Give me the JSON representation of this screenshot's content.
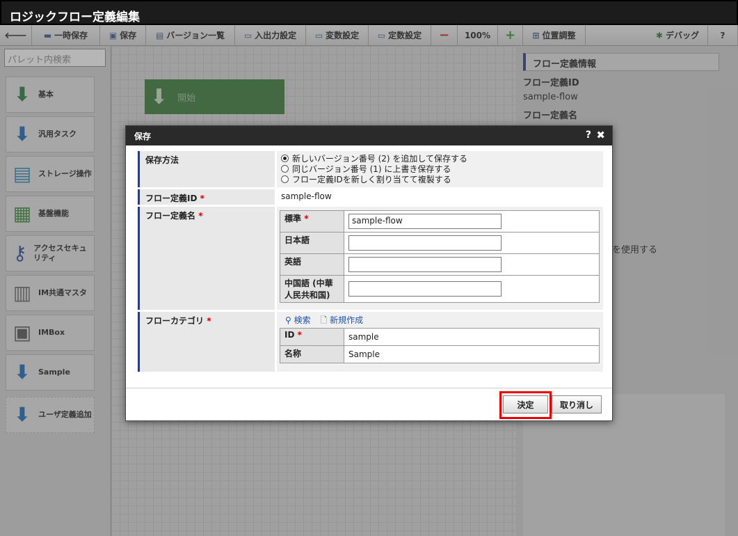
{
  "app": {
    "title": "ロジックフロー定義編集"
  },
  "toolbar": {
    "back_label": "",
    "temp_save": "一時保存",
    "save": "保存",
    "version_list": "バージョン一覧",
    "io_settings": "入出力設定",
    "var_settings": "変数設定",
    "const_settings": "定数設定",
    "zoom_out": "−",
    "zoom": "100%",
    "zoom_in": "+",
    "position": "位置調整",
    "debug": "デバッグ",
    "help": "?"
  },
  "palette": {
    "search_placeholder": "パレット内検索",
    "items": [
      {
        "label": "基本"
      },
      {
        "label": "汎用タスク"
      },
      {
        "label": "ストレージ操作"
      },
      {
        "label": "基盤機能"
      },
      {
        "label": "アクセスセキュリティ"
      },
      {
        "label": "IM共通マスタ"
      },
      {
        "label": "IMBox"
      },
      {
        "label": "Sample"
      },
      {
        "label": "ユーザ定義追加"
      }
    ]
  },
  "canvas": {
    "start_node": "開始"
  },
  "right_panel": {
    "header": "フロー定義情報",
    "flow_id_label": "フロー定義ID",
    "flow_id_value": "sample-flow",
    "flow_name_label": "フロー定義名",
    "partial_text": "を使用する"
  },
  "dialog": {
    "title": "保存",
    "help": "?",
    "close": "✖",
    "save_method_label": "保存方法",
    "save_options": [
      {
        "label": "新しいバージョン番号 (2) を追加して保存する",
        "selected": true
      },
      {
        "label": "同じバージョン番号 (1) に上書き保存する",
        "selected": false
      },
      {
        "label": "フロー定義IDを新しく割り当てて複製する",
        "selected": false
      }
    ],
    "flow_id_label": "フロー定義ID",
    "flow_id_value": "sample-flow",
    "flow_name_label": "フロー定義名",
    "required_mark": "*",
    "names": [
      {
        "label": "標準",
        "required": true,
        "value": "sample-flow"
      },
      {
        "label": "日本語",
        "required": false,
        "value": ""
      },
      {
        "label": "英語",
        "required": false,
        "value": ""
      },
      {
        "label": "中国語 (中華人民共和国)",
        "required": false,
        "value": ""
      }
    ],
    "category_label": "フローカテゴリ",
    "search_link": "検索",
    "new_link": "新規作成",
    "category_id_label": "ID",
    "category_id_value": "sample",
    "category_name_label": "名称",
    "category_name_value": "Sample",
    "ok_button": "決定",
    "cancel_button": "取り消し"
  }
}
